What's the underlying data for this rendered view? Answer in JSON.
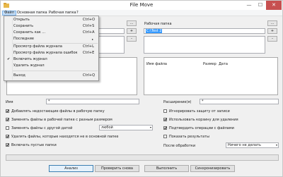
{
  "window": {
    "title": "File Move",
    "min_glyph": "—",
    "max_glyph": "☐",
    "close_glyph": "✕"
  },
  "menubar": {
    "items": [
      "Файл",
      "Основная папка",
      "Рабочая папка",
      "?"
    ]
  },
  "file_menu": {
    "items": [
      {
        "label": "Открыть",
        "shortcut": "Ctrl+O"
      },
      {
        "label": "Сохранить",
        "shortcut": "Ctrl+S"
      },
      {
        "label": "Сохранить как ...",
        "shortcut": "Ctrl+A"
      },
      {
        "label": "Последние",
        "submenu_glyph": "▸"
      },
      {
        "label": "Просмотр файла журнала",
        "shortcut": "Ctrl+L"
      },
      {
        "label": "Просмотр файла журнала ошибок",
        "shortcut": "Ctrl+E"
      },
      {
        "label": "Включить журнал",
        "checked": true,
        "check_glyph": "✔"
      },
      {
        "label": "Удалить журнал"
      },
      {
        "label": "Выход",
        "shortcut": "Ctrl+Q"
      }
    ]
  },
  "left_panel": {
    "browse_label": "...",
    "add_label": "+",
    "remove_label": "-"
  },
  "right_panel": {
    "label": "Рабочая папка",
    "browse_label": "...",
    "path_value": "C:\\Test 2",
    "add_label": "+",
    "remove_label": "-",
    "columns": [
      "Имя файла",
      "Размер",
      "Дата"
    ]
  },
  "filters": {
    "name_label": "Имя",
    "name_value": "*",
    "ext_label": "Расширение(я)",
    "ext_value": "*"
  },
  "options_left": [
    {
      "label": "Добавлять недостающие файлы в рабочую папку",
      "checked": true
    },
    {
      "label": "Заменять файлы в рабочей папке с разным размером",
      "checked": true
    },
    {
      "label": "Заменять файлы с другой датой",
      "checked": false
    },
    {
      "label": "Удалять файлы, которые находятся не в основной папке",
      "checked": true
    },
    {
      "label": "Включать пустые папки",
      "checked": true
    }
  ],
  "date_combo": {
    "value": "любой",
    "arrow": "▾"
  },
  "options_right": [
    {
      "label": "Игнорировать защиту от записи",
      "checked": false
    },
    {
      "label": "Использовать корзину для удаления",
      "checked": true
    },
    {
      "label": "Подтвердить операции с файлами",
      "checked": true
    },
    {
      "label": "Показать результаты",
      "checked": false
    }
  ],
  "after_processing": {
    "label": "После обработки",
    "value": "Ничего не делать",
    "arrow": "▾"
  },
  "buttons": [
    "Анализ",
    "Проверить снова",
    "Выполнить",
    "Синхронизировать"
  ],
  "colors": {
    "accent": "#3399ff",
    "close_bg": "#c75050",
    "menu_active": "#c4ddf6"
  }
}
